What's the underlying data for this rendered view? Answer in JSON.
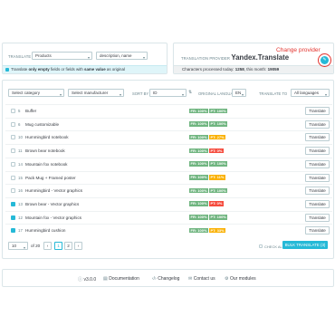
{
  "translate_panel": {
    "label": "TRANSLATE",
    "entity_select": "Products",
    "fields_select": "description, name",
    "info_prefix": "Translate ",
    "info_bold1": "only empty",
    "info_mid": " fields or fields with ",
    "info_bold2": "same value",
    "info_suffix": " as original"
  },
  "provider_panel": {
    "label": "TRANSLATION PROVIDER",
    "provider": "Yandex.Translate",
    "change_provider": "Change provider",
    "stats_prefix": "Characters processed today: ",
    "stats_today": "1258",
    "stats_mid": ", this month: ",
    "stats_month": "19059",
    "edit_icon": "pencil-icon"
  },
  "filters": {
    "category": "Select category",
    "manufacturer": "Select manufacturer",
    "sort_by_label": "SORT BY",
    "sort_value": "ID",
    "original_language_label": "ORIGINAL LANGUAGE",
    "original_language": "EN",
    "translate_to_label": "TRANSLATE TO",
    "translate_to": "All languages"
  },
  "rows": [
    {
      "id": "5",
      "name": "Buffer",
      "checked": false,
      "badges": [
        {
          "text": "FR: 100%",
          "color": "green"
        },
        {
          "text": "PT: 100%",
          "color": "green"
        }
      ],
      "action": "Translate"
    },
    {
      "id": "6",
      "name": "Mug customizable",
      "checked": false,
      "badges": [
        {
          "text": "FR: 100%",
          "color": "green"
        },
        {
          "text": "PT: 100%",
          "color": "green"
        }
      ],
      "action": "Translate"
    },
    {
      "id": "10",
      "name": "Hummingbird notebook",
      "checked": false,
      "badges": [
        {
          "text": "FR: 100%",
          "color": "green"
        },
        {
          "text": "PT: 27%",
          "color": "orange"
        }
      ],
      "action": "Translate"
    },
    {
      "id": "11",
      "name": "Brown bear notebook",
      "checked": false,
      "badges": [
        {
          "text": "FR: 100%",
          "color": "green"
        },
        {
          "text": "PT: 0%",
          "color": "red"
        }
      ],
      "action": "Translate"
    },
    {
      "id": "14",
      "name": "Mountain fox notebook",
      "checked": false,
      "badges": [
        {
          "text": "FR: 100%",
          "color": "green"
        },
        {
          "text": "PT: 100%",
          "color": "green"
        }
      ],
      "action": "Translate"
    },
    {
      "id": "15",
      "name": "Pack Mug + Framed poster",
      "checked": false,
      "badges": [
        {
          "text": "FR: 100%",
          "color": "green"
        },
        {
          "text": "PT: 11%",
          "color": "orange"
        }
      ],
      "action": "Translate"
    },
    {
      "id": "16",
      "name": "Hummingbird - Vector graphics",
      "checked": false,
      "badges": [
        {
          "text": "FR: 100%",
          "color": "green"
        },
        {
          "text": "PT: 100%",
          "color": "green"
        }
      ],
      "action": "Translate"
    },
    {
      "id": "13",
      "name": "Brown bear - Vector graphics",
      "checked": true,
      "badges": [
        {
          "text": "FR: 100%",
          "color": "green"
        },
        {
          "text": "PT: 0%",
          "color": "red"
        }
      ],
      "action": "Translate"
    },
    {
      "id": "12",
      "name": "Mountain fox - Vector graphics",
      "checked": true,
      "badges": [
        {
          "text": "FR: 100%",
          "color": "green"
        },
        {
          "text": "PT: 100%",
          "color": "green"
        }
      ],
      "action": "Translate"
    },
    {
      "id": "17",
      "name": "Hummingbird cushion",
      "checked": true,
      "badges": [
        {
          "text": "FR: 100%",
          "color": "green"
        },
        {
          "text": "PT: 33%",
          "color": "orange"
        }
      ],
      "action": "Translate"
    }
  ],
  "pagination": {
    "per_page": "10",
    "of_label": "of 20",
    "prev": "‹",
    "page1": "1",
    "page2": "2",
    "next": "›",
    "check_all": "CHECK ALL",
    "bulk_translate": "BULK TRANSLATE (3)"
  },
  "footer": {
    "version": "v3.0.0",
    "documentation": "Documentation",
    "changelog": "Changelog",
    "contact": "Contact us",
    "modules": "Our modules"
  },
  "colors": {
    "accent": "#25b9d7",
    "highlight": "#e3342f",
    "green": "#70b580",
    "orange": "#fab000",
    "red": "#f54c3e"
  }
}
